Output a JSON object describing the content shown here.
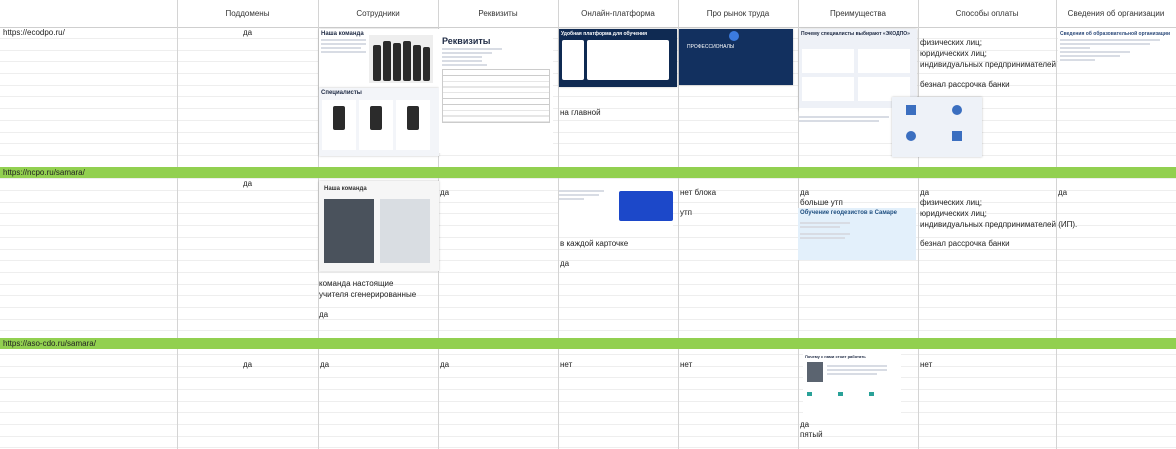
{
  "columns": [
    "",
    "Поддомены",
    "Сотрудники",
    "Реквизиты",
    "Онлайн-платформа",
    "Про рынок труда",
    "Преимущества",
    "Способы оплаты",
    "Сведения об организации"
  ],
  "sites": [
    {
      "url": "https://ecodpo.ru/",
      "subdomains": "да",
      "online_note": "на главной",
      "payment": [
        "физических лиц;",
        "юридических лиц;",
        "индивидуальных предпринимателей (ИП).",
        "безнал рассрочка банки"
      ]
    },
    {
      "url": "https://ncpo.ru/samara/",
      "subdomains": "да",
      "requisites": "да",
      "online_notes": [
        "в каждой карточке",
        "да"
      ],
      "labor_notes": [
        "нет блока",
        "утп"
      ],
      "advantages_notes": [
        "да",
        "больше утп"
      ],
      "payment": [
        "да",
        "физических лиц;",
        "юридических лиц;",
        "индивидуальных предпринимателей (ИП).",
        "безнал рассрочка банки"
      ],
      "org_info": "да",
      "staff_notes": [
        "команда настоящие",
        "учителя сгенерированные",
        "да"
      ]
    },
    {
      "url": "https://aso-cdo.ru/samara/",
      "subdomains": "да",
      "staff": "да",
      "requisites": "да",
      "online": "нет",
      "labor": "нет",
      "advantages_notes": [
        "да",
        "пятый"
      ],
      "payment": "нет"
    }
  ],
  "screenshots": {
    "team": "Наша команда",
    "specialists": "Специалисты",
    "requisites": "Реквизиты",
    "platform": "Удобная платформа для обучения",
    "labor": "ПРОФЕССИОНАЛЫ",
    "why": "Почему специалисты выбирают «ЭКОДПО»",
    "org": "Сведения об образовательной организации",
    "team2": "Наша команда",
    "geodesy": "Обучение геодезистов в Самаре",
    "why2": "Почему с нами стоит работать"
  }
}
